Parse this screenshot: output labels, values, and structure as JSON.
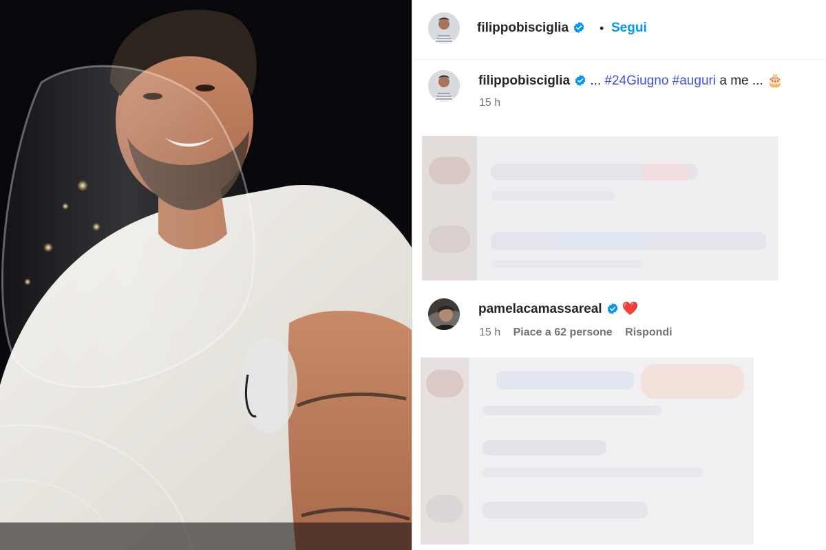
{
  "post_header": {
    "username": "filippobisciglia",
    "verified_icon": "verified-badge-icon",
    "separator": "•",
    "follow_label": "Segui"
  },
  "caption": {
    "username": "filippobisciglia",
    "prefix": "...",
    "hashtags": [
      "#24Giugno",
      "#auguri"
    ],
    "suffix": "a me ...",
    "emoji": "🎂",
    "time": "15 h"
  },
  "comment": {
    "username": "pamelacamassareal",
    "text": "❤️",
    "time": "15 h",
    "likes": "Piace a 62 persone",
    "reply_label": "Rispondi"
  },
  "colors": {
    "accent": "#0095f6",
    "hashtag": "#3f51d8",
    "text": "#262626",
    "muted": "#737373",
    "verified": "#0095f6"
  }
}
